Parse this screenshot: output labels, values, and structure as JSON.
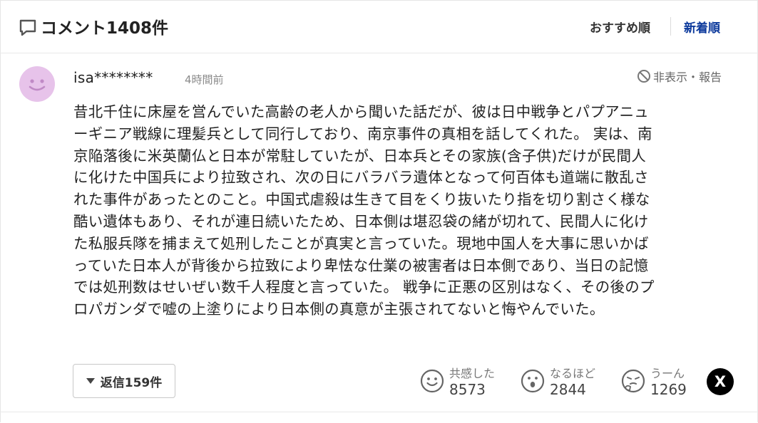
{
  "header": {
    "title": "コメント1408件",
    "sort_recommended": "おすすめ順",
    "sort_newest": "新着順"
  },
  "comment": {
    "username": "isa********",
    "timestamp": "4時間前",
    "hide_report": "非表示・報告",
    "lines": [
      "昔北千住に床屋を営んでいた高齢の老人から聞いた話だが、彼は日中戦争とパプアニュ",
      "ーギニア戦線に理髪兵として同行しており、南京事件の真相を話してくれた。 実は、南",
      "京陥落後に米英蘭仏と日本が常駐していたが、日本兵とその家族(含子供)だけが民間人",
      "に化けた中国兵により拉致され、次の日にバラバラ遺体となって何百体も道端に散乱さ",
      "れた事件があったとのこと。中国式虐殺は生きて目をくり抜いたり指を切り割さく様な",
      "酷い遺体もあり、それが連日続いたため、日本側は堪忍袋の緒が切れて、民間人に化け",
      "た私服兵隊を捕まえて処刑したことが真実と言っていた。現地中国人を大事に思いかば",
      "っていた日本人が背後から拉致により卑怯な仕業の被害者は日本側であり、当日の記憶",
      "では処刑数はせいぜい数千人程度と言っていた。 戦争に正悪の区別はなく、その後のプ",
      "ロパガンダで嘘の上塗りにより日本側の真意が主張されてないと悔やんでいた。"
    ],
    "reply_label": "返信159件",
    "reactions": [
      {
        "icon": "smile-face-icon",
        "label": "共感した",
        "count": "8573"
      },
      {
        "icon": "surprised-face-icon",
        "label": "なるほど",
        "count": "2844"
      },
      {
        "icon": "thinking-face-icon",
        "label": "うーん",
        "count": "1269"
      }
    ],
    "share_icon": "x-share-icon",
    "share_glyph": "X"
  },
  "colors": {
    "accent_blue": "#0d3a9c",
    "avatar_bg": "#e7c3ea",
    "avatar_face": "#c08ac6"
  }
}
